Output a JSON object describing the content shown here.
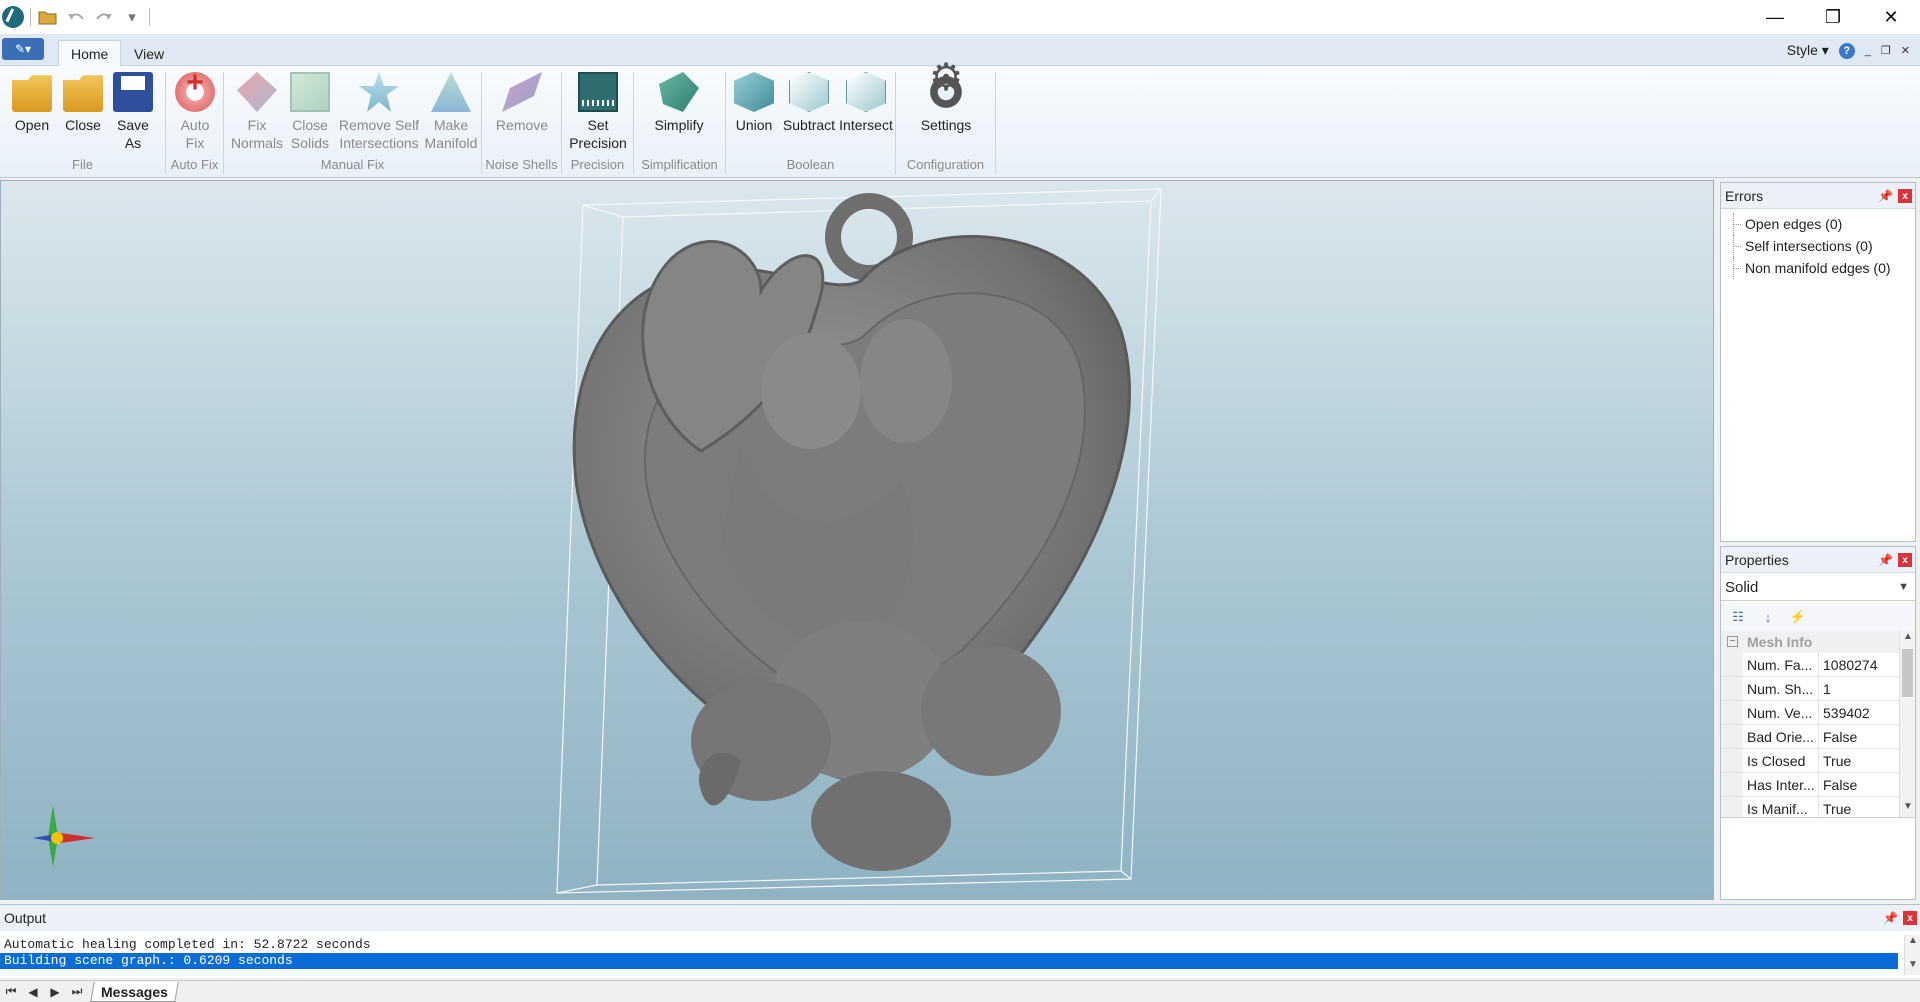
{
  "titlebar": {
    "qat_dropdown": "▾",
    "window_controls": {
      "minimize": "—",
      "restore": "❐",
      "close": "✕"
    }
  },
  "ribbon": {
    "app_menu": "✎▾",
    "tabs": [
      {
        "label": "Home",
        "active": true
      },
      {
        "label": "View",
        "active": false
      }
    ],
    "style_label": "Style",
    "style_dropdown": "▾",
    "help": "?",
    "mdi_controls": {
      "minimize": "_",
      "restore": "❐",
      "close": "✕"
    },
    "groups": {
      "file": {
        "label": "File",
        "buttons": {
          "open": "Open",
          "close": "Close",
          "save_as_1": "Save",
          "save_as_2": "As"
        }
      },
      "autofix": {
        "label": "Auto Fix",
        "buttons": {
          "auto_fix_1": "Auto",
          "auto_fix_2": "Fix"
        }
      },
      "manualfix": {
        "label": "Manual Fix",
        "buttons": {
          "fix_normals_1": "Fix",
          "fix_normals_2": "Normals",
          "close_solids_1": "Close",
          "close_solids_2": "Solids",
          "remove_self_1": "Remove Self",
          "remove_self_2": "Intersections",
          "make_manifold_1": "Make",
          "make_manifold_2": "Manifold"
        }
      },
      "noise": {
        "label": "Noise Shells",
        "buttons": {
          "remove": "Remove"
        }
      },
      "precision": {
        "label": "Precision",
        "buttons": {
          "set_precision_1": "Set",
          "set_precision_2": "Precision"
        }
      },
      "simplification": {
        "label": "Simplification",
        "buttons": {
          "simplify": "Simplify"
        }
      },
      "boolean": {
        "label": "Boolean",
        "buttons": {
          "union": "Union",
          "subtract": "Subtract",
          "intersect": "Intersect"
        }
      },
      "configuration": {
        "label": "Configuration",
        "buttons": {
          "settings": "Settings"
        }
      }
    }
  },
  "errors_panel": {
    "title": "Errors",
    "items": [
      "Open edges (0)",
      "Self intersections (0)",
      "Non manifold edges (0)"
    ]
  },
  "properties_panel": {
    "title": "Properties",
    "selected_object": "Solid",
    "category": "Mesh Info",
    "rows": [
      {
        "name": "Num. Fa...",
        "value": "1080274"
      },
      {
        "name": "Num. Sh...",
        "value": "1"
      },
      {
        "name": "Num. Ve...",
        "value": "539402"
      },
      {
        "name": "Bad Orie...",
        "value": "False"
      },
      {
        "name": "Is Closed",
        "value": "True"
      },
      {
        "name": "Has Inter...",
        "value": "False"
      },
      {
        "name": "Is Manif...",
        "value": "True"
      }
    ]
  },
  "output_panel": {
    "title": "Output",
    "lines": [
      "Automatic healing completed in: 52.8722 seconds",
      "Building scene graph.: 0.6209 seconds"
    ]
  },
  "bottom_tabs": {
    "nav": [
      "⏮",
      "◀",
      "▶",
      "⏭"
    ],
    "sheet": "Messages"
  },
  "colors": {
    "selection": "#0a6cd6",
    "close_button": "#d9343a",
    "viewport_top": "#dbe7ed",
    "viewport_bottom": "#8fb3c3",
    "model": "#7d7d7d"
  }
}
